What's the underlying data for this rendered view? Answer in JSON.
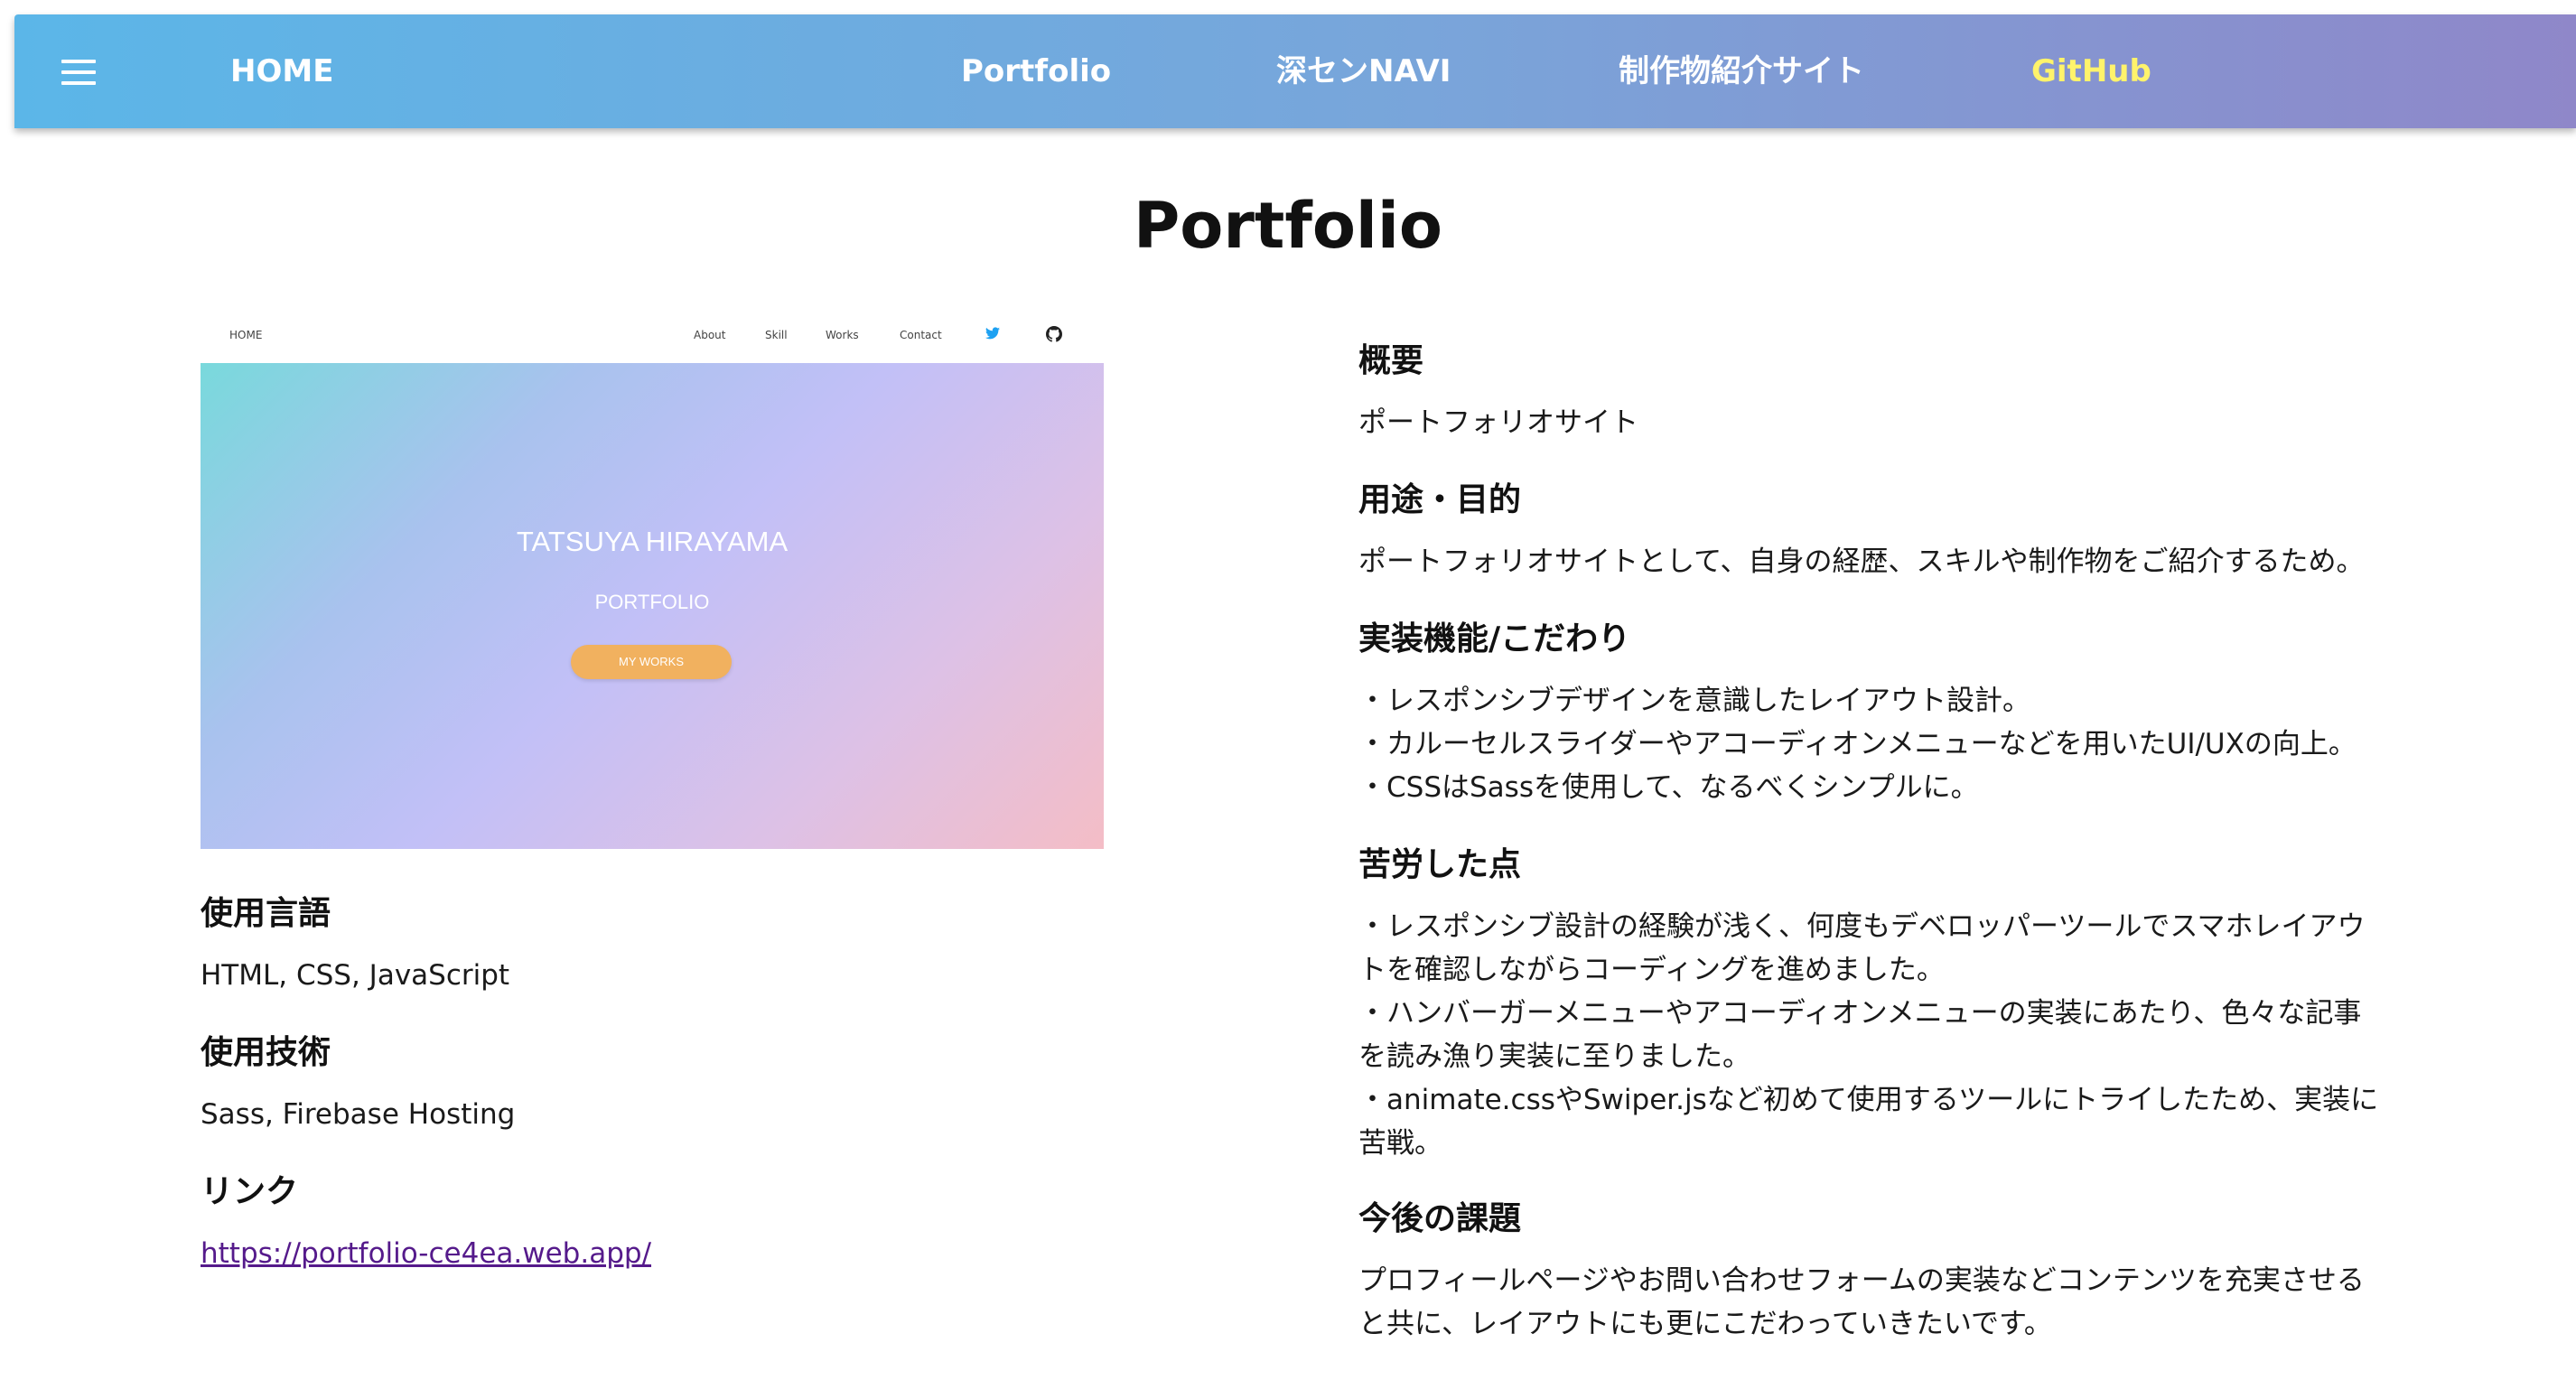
{
  "nav": {
    "home": "HOME",
    "portfolio": "Portfolio",
    "fukasen": "深センNAVI",
    "works_site": "制作物紹介サイト",
    "github": "GitHub"
  },
  "page": {
    "title": "Portfolio"
  },
  "preview": {
    "nav_home": "HOME",
    "nav_items": [
      "About",
      "Skill",
      "Works",
      "Contact"
    ],
    "name": "TATSUYA HIRAYAMA",
    "subtitle": "PORTFOLIO",
    "button": "MY WORKS"
  },
  "left": {
    "lang_heading": "使用言語",
    "lang_value": "HTML, CSS, JavaScript",
    "tech_heading": "使用技術",
    "tech_value": "Sass, Firebase Hosting",
    "link_heading": "リンク",
    "link_url": "https://portfolio-ce4ea.web.app/"
  },
  "right": {
    "overview_heading": "概要",
    "overview_text": "ポートフォリオサイト",
    "purpose_heading": "用途・目的",
    "purpose_text": "ポートフォリオサイトとして、自身の経歴、スキルや制作物をご紹介するため。",
    "features_heading": "実装機能/こだわり",
    "features": [
      "・レスポンシブデザインを意識したレイアウト設計。",
      "・カルーセルスライダーやアコーディオンメニューなどを用いたUI/UXの向上。",
      "・CSSはSassを使用して、なるべくシンプルに。"
    ],
    "struggle_heading": "苦労した点",
    "struggle_lines": [
      "・レスポンシブ設計の経験が浅く、何度もデベロッパーツールでスマホレイアウ",
      "トを確認しながらコーディングを進めました。",
      "・ハンバーガーメニューやアコーディオンメニューの実装にあたり、色々な記事",
      "を読み漁り実装に至りました。",
      "・animate.cssやSwiper.jsなど初めて使用するツールにトライしたため、実装に",
      "苦戦。"
    ],
    "future_heading": "今後の課題",
    "future_lines": [
      "プロフィールページやお問い合わせフォームの実装などコンテンツを充実させる",
      "と共に、レイアウトにも更にこだわっていきたいです。"
    ]
  },
  "colors": {
    "nav_gradient_start": "#5bb6e8",
    "nav_gradient_end": "#8f87c9",
    "github_link": "#fff36b",
    "visited_link": "#551a8b",
    "preview_button": "#f1b15f",
    "twitter_blue": "#1da1f2"
  },
  "icons": [
    "hamburger-menu-icon",
    "twitter-icon",
    "github-icon"
  ]
}
